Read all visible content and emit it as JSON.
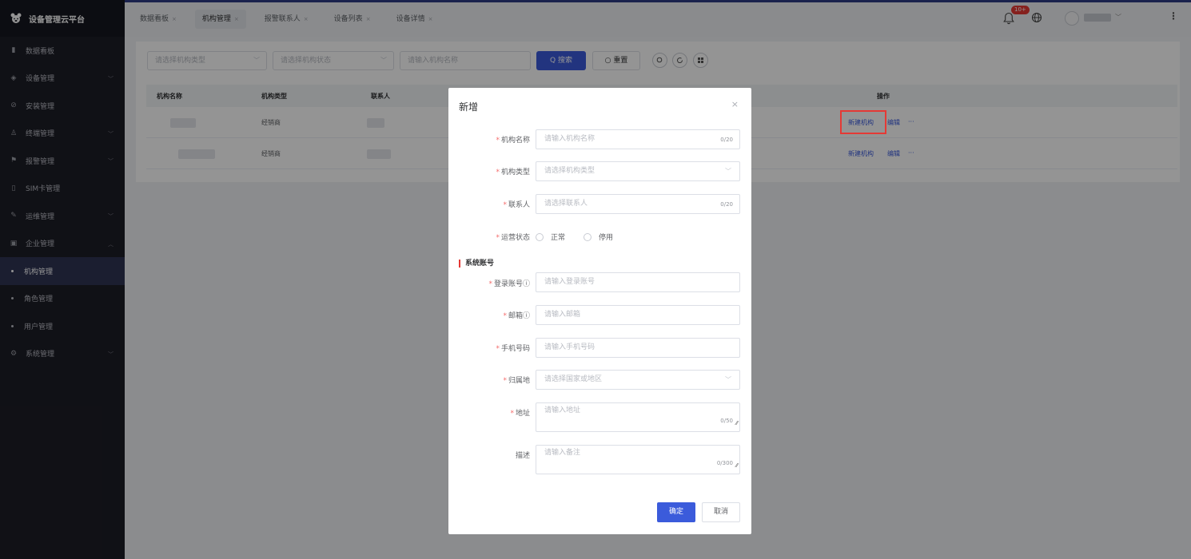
{
  "app": {
    "title": "设备管理云平台",
    "logo_icon": "bear-logo-icon"
  },
  "sidebar": {
    "items": [
      {
        "label": "数据看板",
        "icon": "▮",
        "has_chevron": false
      },
      {
        "label": "设备管理",
        "icon": "◈",
        "has_chevron": true
      },
      {
        "label": "安装管理",
        "icon": "⊘",
        "has_chevron": false
      },
      {
        "label": "终端管理",
        "icon": "♙",
        "has_chevron": true
      },
      {
        "label": "报警管理",
        "icon": "⚑",
        "has_chevron": true
      },
      {
        "label": "SIM卡管理",
        "icon": "▯",
        "has_chevron": false
      },
      {
        "label": "运维管理",
        "icon": "✎",
        "has_chevron": true
      },
      {
        "label": "企业管理",
        "icon": "▣",
        "has_chevron": true,
        "expanded": true
      }
    ],
    "subitems": [
      {
        "label": "机构管理",
        "active": true
      },
      {
        "label": "角色管理"
      },
      {
        "label": "用户管理"
      }
    ],
    "last_item": {
      "label": "系统管理",
      "icon": "⚙",
      "has_chevron": true
    },
    "chevron_down": "﹀",
    "chevron_up": "︿"
  },
  "tabs": [
    {
      "label": "数据看板"
    },
    {
      "label": "机构管理",
      "active": true
    },
    {
      "label": "报警联系人"
    },
    {
      "label": "设备列表"
    },
    {
      "label": "设备详情"
    }
  ],
  "tab_close": "×",
  "topbar": {
    "badge": "10+",
    "user_chevron": "﹀",
    "kebab": "⋮"
  },
  "filters": {
    "org_type_placeholder": "请选择机构类型",
    "org_status_placeholder": "请选择机构状态",
    "org_name_placeholder": "请输入机构名称",
    "search_label": "Q 搜索",
    "reset_label": "○ 重置",
    "dropdown_arrow": "﹀"
  },
  "table": {
    "columns": [
      "机构名称",
      "机构类型",
      "联系人",
      "操作"
    ],
    "rows": [
      {
        "type": "经销商",
        "actions": [
          "新建机构",
          "编辑",
          "···"
        ]
      },
      {
        "type": "经销商",
        "actions": [
          "新建机构",
          "编辑",
          "···"
        ]
      }
    ]
  },
  "modal": {
    "title": "新增",
    "close": "×",
    "fields": {
      "org_name": {
        "label": "机构名称",
        "placeholder": "请输入机构名称",
        "counter": "0/20"
      },
      "org_type": {
        "label": "机构类型",
        "placeholder": "请选择机构类型"
      },
      "contact": {
        "label": "联系人",
        "placeholder": "请选择联系人",
        "counter": "0/20"
      },
      "status": {
        "label": "运营状态",
        "option_normal": "正常",
        "option_disabled": "停用"
      },
      "login": {
        "label": "登录账号ⓘ",
        "placeholder": "请输入登录账号"
      },
      "email": {
        "label": "邮箱ⓘ",
        "placeholder": "请输入邮箱"
      },
      "phone": {
        "label": "手机号码",
        "placeholder": "请输入手机号码"
      },
      "region": {
        "label": "归属地",
        "placeholder": "请选择国家或地区"
      },
      "address": {
        "label": "地址",
        "placeholder": "请输入地址",
        "counter": "0/50"
      },
      "desc": {
        "label": "描述",
        "placeholder": "请输入备注",
        "counter": "0/300"
      }
    },
    "section_title": "系统账号",
    "required_mark": "*",
    "resize_glyph": "⁄⁄",
    "ok_label": "确定",
    "cancel_label": "取消"
  },
  "colors": {
    "primary": "#3b5bdb",
    "sidebar_bg": "#1d1e26",
    "highlight": "#e53935"
  }
}
